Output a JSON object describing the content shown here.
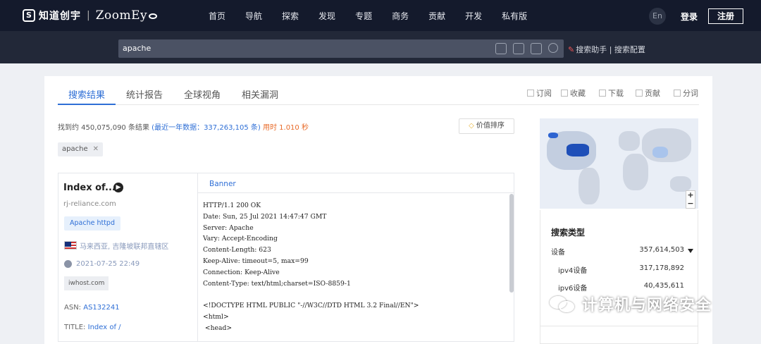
{
  "header": {
    "logo_cn": "知道创宇",
    "logo_en": "ZoomEy",
    "nav": [
      "首页",
      "导航",
      "探索",
      "发现",
      "专题",
      "商务",
      "贡献",
      "开发",
      "私有版"
    ],
    "lang": "En",
    "login": "登录",
    "register": "注册"
  },
  "search": {
    "query": "apache",
    "assistant": "搜索助手 | 搜索配置"
  },
  "tabs": [
    "搜索结果",
    "统计报告",
    "全球视角",
    "相关漏洞"
  ],
  "actions": [
    "订阅",
    "收藏",
    "下载",
    "贡献",
    "分词"
  ],
  "summary": {
    "prefix": "找到约 450,075,090 条结果",
    "recent": "(最近一年数据：337,263,105 条)",
    "time": "用时 1.010 秒"
  },
  "value_sort": "价值排序",
  "filter_chip": "apache",
  "result": {
    "title": "Index of...",
    "host": "rj-reliance.com",
    "tag": "Apache httpd",
    "location": "马来西亚, 吉隆坡联邦直辖区",
    "timestamp": "2021-07-25 22:49",
    "hosting": "iwhost.com",
    "asn_label": "ASN:",
    "asn_value": "AS132241",
    "title_label": "TITLE:",
    "title_value": "Index of /",
    "banner_tab": "Banner",
    "banner": "HTTP/1.1 200 OK\nDate: Sun, 25 Jul 2021 14:47:47 GMT\nServer: Apache\nVary: Accept-Encoding\nContent-Length: 623\nKeep-Alive: timeout=5, max=99\nConnection: Keep-Alive\nContent-Type: text/html;charset=ISO-8859-1\n\n<!DOCTYPE HTML PUBLIC \"-//W3C//DTD HTML 3.2 Final//EN\">\n<html>\n <head>"
  },
  "stats": {
    "title": "搜索类型",
    "rows": [
      {
        "label": "设备",
        "value": "357,614,503"
      },
      {
        "label": "ipv4设备",
        "value": "317,178,892"
      },
      {
        "label": "ipv6设备",
        "value": "40,435,611"
      }
    ]
  },
  "map": {
    "zoom_in": "+",
    "zoom_out": "−"
  },
  "watermark": "计算机与网络安全",
  "colors": {
    "accent": "#2f6fd6",
    "topbar": "#141a2c",
    "orange": "#e86b2a"
  }
}
